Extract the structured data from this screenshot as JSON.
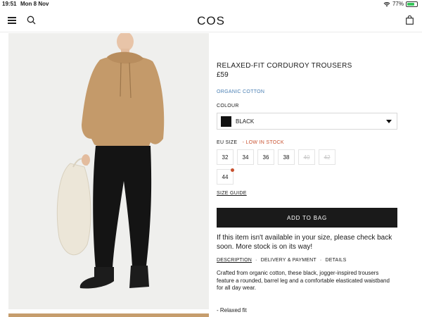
{
  "status": {
    "time": "19:51",
    "date": "Mon 8 Nov",
    "battery": "77%",
    "battery_level": 0.77
  },
  "header": {
    "logo": "COS"
  },
  "product": {
    "title": "RELAXED-FIT CORDUROY TROUSERS",
    "price": "£59",
    "material": "ORGANIC COTTON"
  },
  "colour": {
    "label": "COLOUR",
    "selected": "BLACK",
    "swatch": "#111111"
  },
  "size": {
    "label": "EU SIZE",
    "stock_note": "- LOW IN STOCK",
    "options": [
      {
        "label": "32",
        "available": true
      },
      {
        "label": "34",
        "available": true
      },
      {
        "label": "36",
        "available": true
      },
      {
        "label": "38",
        "available": true
      },
      {
        "label": "40",
        "available": false
      },
      {
        "label": "42",
        "available": false
      },
      {
        "label": "44",
        "available": true,
        "low_stock": true
      }
    ]
  },
  "size_guide": "SIZE GUIDE",
  "add_to_bag": "ADD TO BAG",
  "notice": "If this item isn't available in your size, please check back soon. More stock is on its way!",
  "tabs": [
    {
      "label": "DESCRIPTION",
      "active": true
    },
    {
      "label": "DELIVERY & PAYMENT",
      "active": false
    },
    {
      "label": "DETAILS",
      "active": false
    }
  ],
  "description": "Crafted from organic cotton, these black, jogger-inspired trousers feature a rounded, barrel leg and a comfortable elasticated waistband for all day wear.",
  "bullet": "- Relaxed fit",
  "colors": {
    "accent_blue": "#4a7fb3",
    "stock_red": "#c8502e",
    "button_black": "#1a1a1a"
  }
}
